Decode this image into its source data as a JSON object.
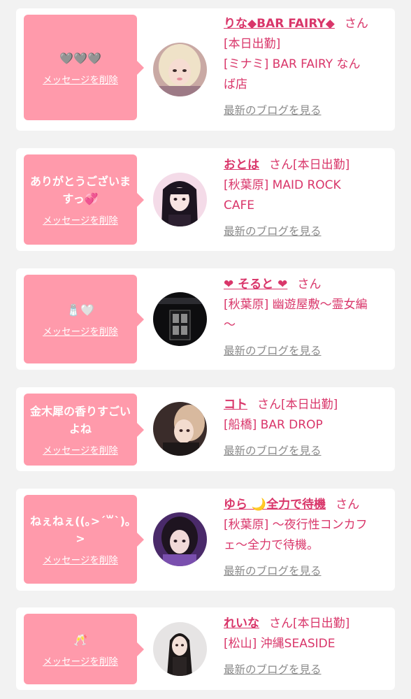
{
  "labels": {
    "delete_message": "メッセージを削除",
    "san": "さん",
    "view_blog": "最新のブログを見る"
  },
  "colors": {
    "page_bg": "#f2f2f2",
    "card_bg": "#ffffff",
    "bubble_bg": "#ff9aab",
    "accent": "#d9366a",
    "link_gray": "#8a8a8a"
  },
  "messages": [
    {
      "message": "🩶🩶🩶",
      "name": "りな◆BAR FAIRY◆",
      "shop_line1": "[本日出勤]",
      "shop_line2": "[ミナミ] BAR FAIRY なん",
      "shop_line3": "ば店"
    },
    {
      "message": "ありがとうございますっ💞",
      "name": "おとは",
      "shop_line1": "[本日出勤]",
      "shop_line2": "[秋葉原] MAID ROCK",
      "shop_line3": "CAFE"
    },
    {
      "message": "🧂🤍",
      "name": "❤ そると ❤",
      "shop_line1": "",
      "shop_line2": "[秋葉原] 幽遊屋敷〜霊女編",
      "shop_line3": "〜"
    },
    {
      "message": "金木犀の香りすごいよね",
      "name": "コト",
      "shop_line1": "[本日出勤]",
      "shop_line2": "[船橋] BAR DROP",
      "shop_line3": ""
    },
    {
      "message": "ねぇねぇ((｡>ˊ꒳ˋ)｡>",
      "name": "ゆら 🌙全力で待機",
      "shop_line1": "",
      "shop_line2": "[秋葉原] 〜夜行性コンカフ",
      "shop_line3": "ェ〜全力で待機。"
    },
    {
      "message": "🥂",
      "name": "れいな",
      "shop_line1": "[本日出勤]",
      "shop_line2": "[松山] 沖縄SEASIDE",
      "shop_line3": ""
    }
  ]
}
